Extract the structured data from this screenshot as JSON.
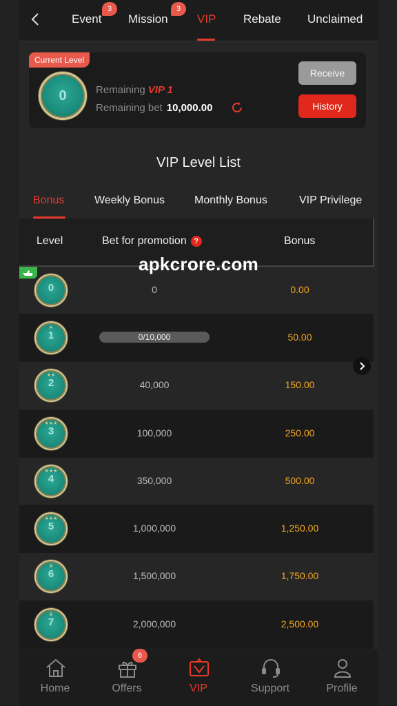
{
  "topnav": {
    "tabs": [
      {
        "label": "Event",
        "badge": "3"
      },
      {
        "label": "Mission",
        "badge": "3"
      },
      {
        "label": "VIP",
        "active": true
      },
      {
        "label": "Rebate"
      },
      {
        "label": "Unclaimed"
      }
    ]
  },
  "current": {
    "tag": "Current Level",
    "level": "0",
    "remaining_label": "Remaining",
    "remaining_vip": "VIP 1",
    "remaining_bet_label": "Remaining bet",
    "remaining_bet_value": "10,000.00",
    "receive_label": "Receive",
    "history_label": "History"
  },
  "list": {
    "title": "VIP Level List",
    "tabs": [
      "Bonus",
      "Weekly Bonus",
      "Monthly Bonus",
      "VIP Privilege"
    ],
    "headers": {
      "level": "Level",
      "bet": "Bet for promotion",
      "bonus": "Bonus",
      "help": "?"
    },
    "rows": [
      {
        "level": "0",
        "bet": "0",
        "bonus": "0.00"
      },
      {
        "level": "1",
        "bet": "0/10,000",
        "bonus": "50.00",
        "progress": 0
      },
      {
        "level": "2",
        "bet": "40,000",
        "bonus": "150.00"
      },
      {
        "level": "3",
        "bet": "100,000",
        "bonus": "250.00"
      },
      {
        "level": "4",
        "bet": "350,000",
        "bonus": "500.00"
      },
      {
        "level": "5",
        "bet": "1,000,000",
        "bonus": "1,250.00"
      },
      {
        "level": "6",
        "bet": "1,500,000",
        "bonus": "1,750.00"
      },
      {
        "level": "7",
        "bet": "2,000,000",
        "bonus": "2,500.00"
      }
    ]
  },
  "watermark": "apkcrore.com",
  "bottomnav": {
    "items": [
      {
        "label": "Home",
        "icon": "home-icon"
      },
      {
        "label": "Offers",
        "icon": "gift-icon",
        "badge": "6"
      },
      {
        "label": "VIP",
        "icon": "vip-crown-icon",
        "active": true
      },
      {
        "label": "Support",
        "icon": "headset-icon"
      },
      {
        "label": "Profile",
        "icon": "user-icon"
      }
    ]
  },
  "colors": {
    "accent": "#e8392c",
    "bonus": "#f5a623",
    "medal": "#1b8b7b",
    "background": "#222222"
  }
}
